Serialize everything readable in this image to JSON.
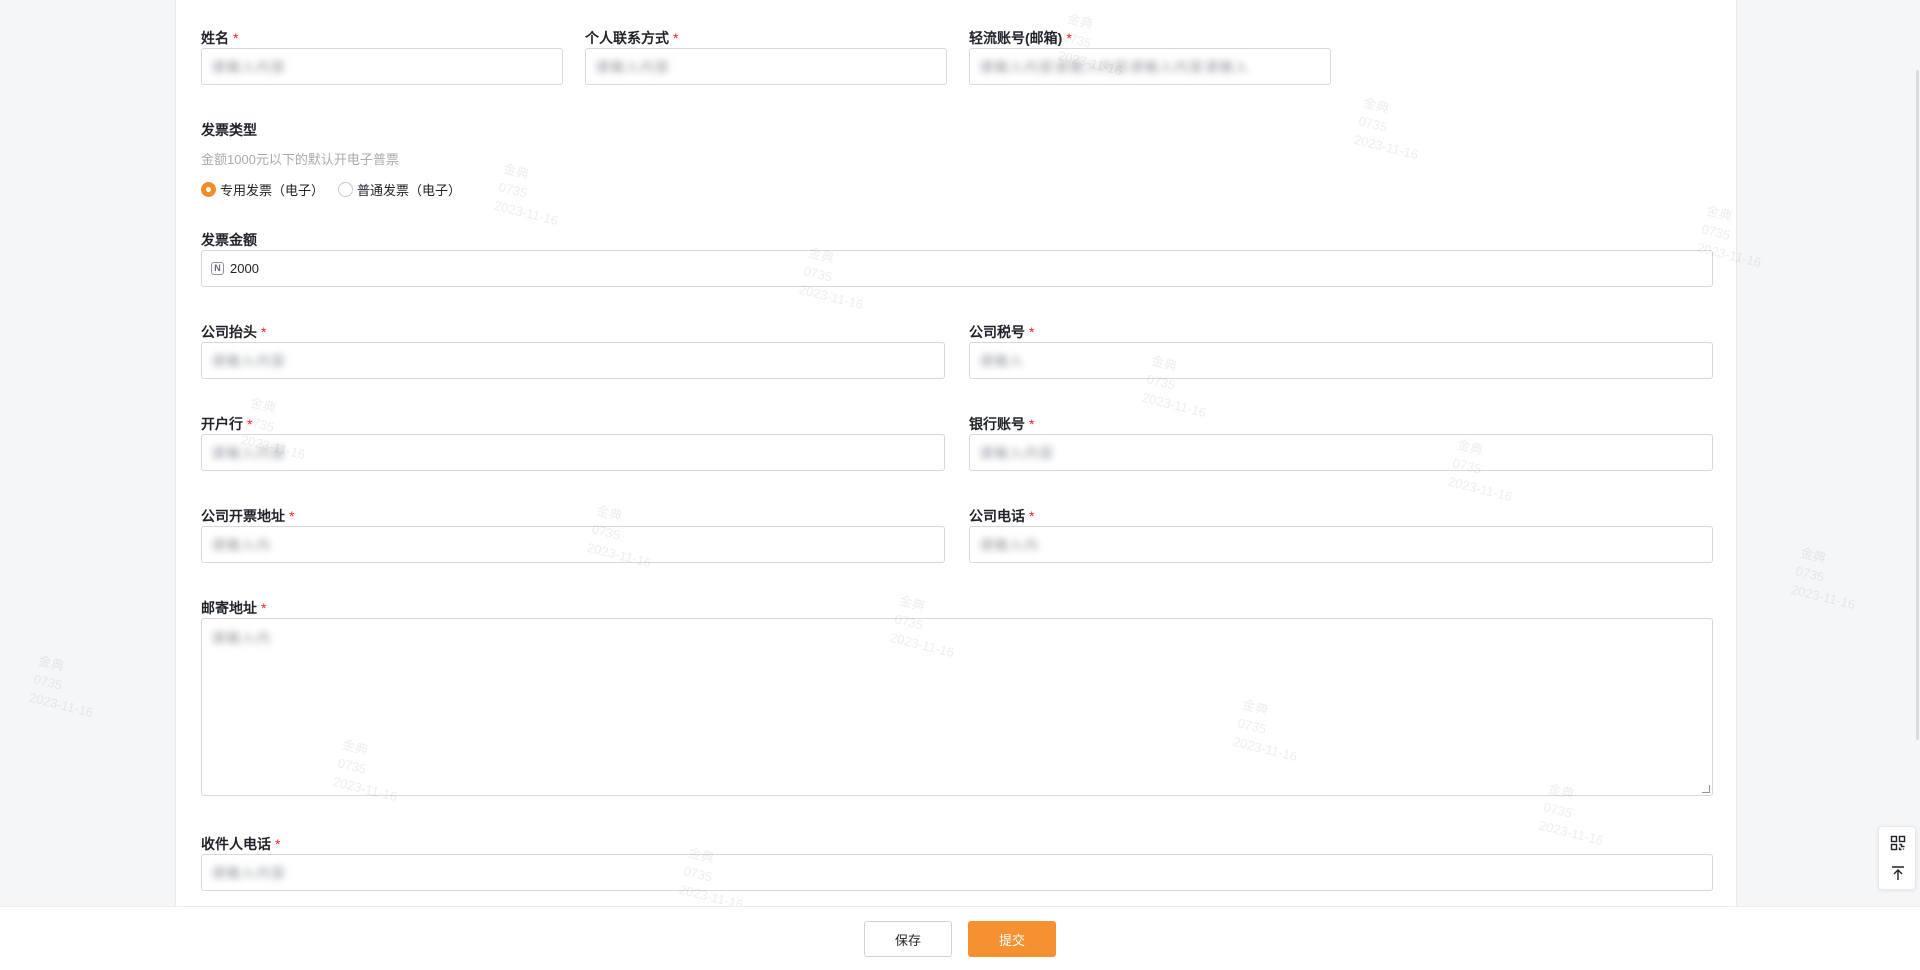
{
  "form": {
    "name": {
      "label": "姓名",
      "required_mark": "*"
    },
    "contact": {
      "label": "个人联系方式",
      "required_mark": "*"
    },
    "account": {
      "label": "轻流账号(邮箱)",
      "required_mark": "*"
    },
    "invoice_type": {
      "label": "发票类型",
      "hint": "金额1000元以下的默认开电子普票",
      "options": [
        "专用发票（电子）",
        "普通发票（电子）"
      ],
      "selected": "专用发票（电子）"
    },
    "amount": {
      "label": "发票金额",
      "icon": "number-icon",
      "value": "2000"
    },
    "company_title": {
      "label": "公司抬头",
      "required_mark": "*"
    },
    "tax_id": {
      "label": "公司税号",
      "required_mark": "*"
    },
    "bank": {
      "label": "开户行",
      "required_mark": "*"
    },
    "bank_account": {
      "label": "银行账号",
      "required_mark": "*"
    },
    "invoice_address": {
      "label": "公司开票地址",
      "required_mark": "*"
    },
    "company_phone": {
      "label": "公司电话",
      "required_mark": "*"
    },
    "mail_address": {
      "label": "邮寄地址",
      "required_mark": "*"
    },
    "receiver_phone": {
      "label": "收件人电话",
      "required_mark": "*"
    }
  },
  "blurred": {
    "name": "请输入内容",
    "contact": "请输入内容",
    "account": "请输入内容请输入内容请输入内容请输入",
    "company_title": "请输入内容",
    "tax_id": "请输入",
    "bank": "请输入内容",
    "bank_account": "请输入内容",
    "invoice_address": "请输入内",
    "company_phone": "请输入内",
    "mail_address": "请输入内",
    "receiver_phone": "请输入内容"
  },
  "footer": {
    "save_label": "保存",
    "submit_label": "提交"
  },
  "float_tools": {
    "qr_icon": "qrcode-icon",
    "top_icon": "back-to-top-icon"
  },
  "watermark": {
    "line1": "金典",
    "line2": "0735",
    "line3": "2023-11-16"
  },
  "colors": {
    "accent": "#f59130",
    "required": "#f5222d",
    "border": "#d5d8dd"
  }
}
